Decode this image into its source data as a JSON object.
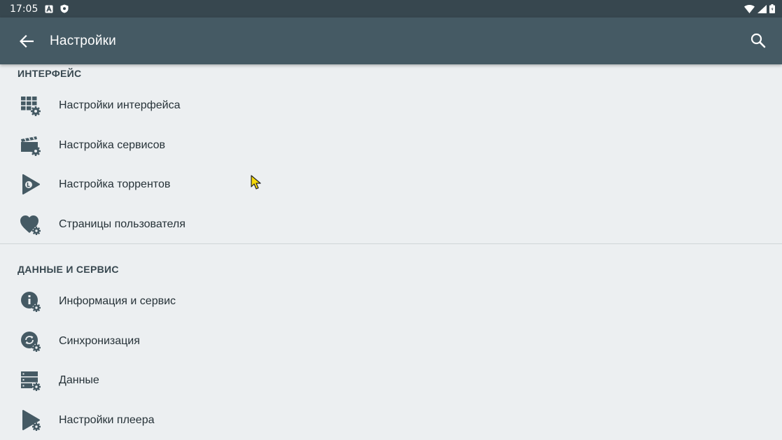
{
  "status_bar": {
    "time": "17:05"
  },
  "toolbar": {
    "title": "Настройки"
  },
  "sections": [
    {
      "header": "ИНТЕРФЕЙС",
      "items": [
        {
          "label": "Настройки интерфейса",
          "icon": "grid-settings-icon"
        },
        {
          "label": "Настройка сервисов",
          "icon": "clapperboard-settings-icon"
        },
        {
          "label": "Настройка торрентов",
          "icon": "torrent-play-icon"
        },
        {
          "label": "Страницы пользователя",
          "icon": "heart-settings-icon"
        }
      ]
    },
    {
      "header": "ДАННЫЕ И СЕРВИС",
      "items": [
        {
          "label": "Информация и сервис",
          "icon": "info-settings-icon"
        },
        {
          "label": "Синхронизация",
          "icon": "sync-settings-icon"
        },
        {
          "label": "Данные",
          "icon": "storage-settings-icon"
        },
        {
          "label": "Настройки плеера",
          "icon": "player-settings-icon"
        }
      ]
    }
  ],
  "colors": {
    "status_bar": "#37474f",
    "toolbar": "#455a64",
    "background": "#eceff1",
    "icon": "#455a64",
    "text": "#263238"
  }
}
